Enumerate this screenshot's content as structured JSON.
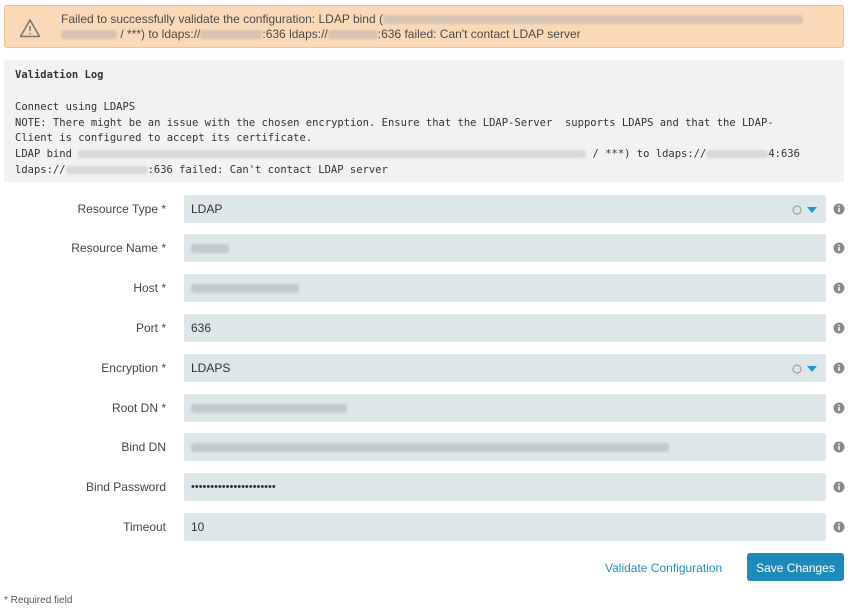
{
  "alert": {
    "icon": "warning-icon",
    "line1_prefix": "Failed to successfully validate the configuration: LDAP bind (",
    "line2_mid": " / ***) to ldaps://",
    "line2_port1": ":636 ldaps://",
    "line2_suffix": ":636 failed: Can't contact LDAP server"
  },
  "log": {
    "title": "Validation Log",
    "line1": "Connect using LDAPS",
    "line2": "NOTE: There might be an issue with the chosen encryption. Ensure that the LDAP-Server  supports LDAPS and that the LDAP-",
    "line3": "Client is configured to accept its certificate.",
    "line4_prefix": "LDAP bind ",
    "line4_mid": " / ***) to ldaps://",
    "line4_suffix": "4:636",
    "line5_prefix": "ldaps://",
    "line5_suffix": ":636 failed: Can't contact LDAP server"
  },
  "form": {
    "resource_type": {
      "label": "Resource Type *",
      "value": "LDAP"
    },
    "resource_name": {
      "label": "Resource Name *"
    },
    "host": {
      "label": "Host *"
    },
    "port": {
      "label": "Port *",
      "value": "636"
    },
    "encryption": {
      "label": "Encryption *",
      "value": "LDAPS"
    },
    "root_dn": {
      "label": "Root DN *"
    },
    "bind_dn": {
      "label": "Bind DN"
    },
    "bind_password": {
      "label": "Bind Password",
      "value": "••••••••••••••••••••••"
    },
    "timeout": {
      "label": "Timeout",
      "value": "10"
    }
  },
  "actions": {
    "validate_label": "Validate Configuration",
    "save_label": "Save Changes"
  },
  "footer": {
    "required_note": "* Required field"
  },
  "colors": {
    "accent": "#1d8ab8",
    "alert_bg": "#f9d9b7",
    "field_bg": "#dde6e9",
    "select_arrow": "#1a9ad6"
  }
}
